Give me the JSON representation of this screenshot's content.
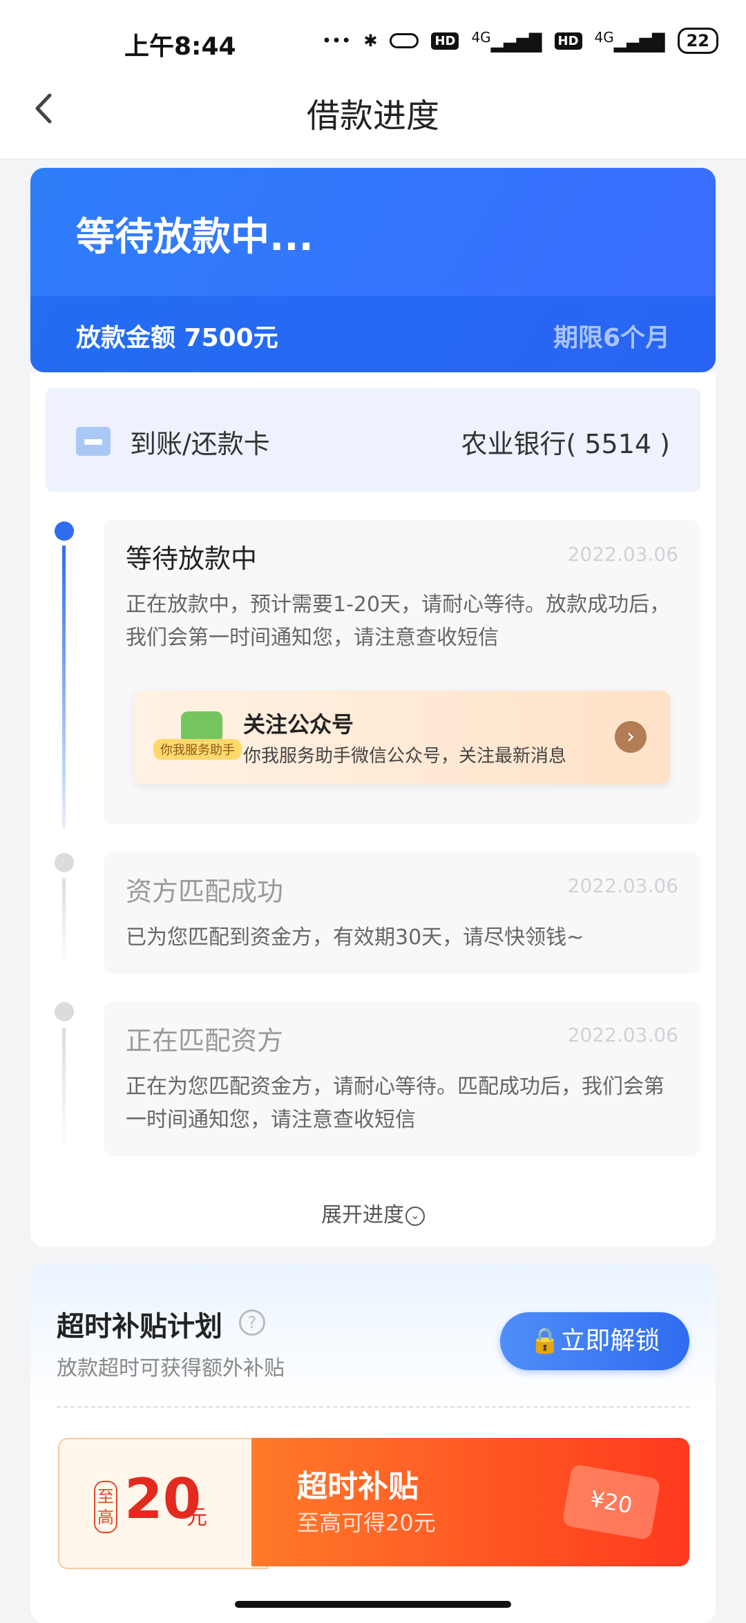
{
  "status_bar": {
    "time": "上午8:44",
    "hd1": "HD",
    "hd2": "HD",
    "net1": "4G",
    "net2": "4G",
    "battery": "22"
  },
  "nav": {
    "title": "借款进度"
  },
  "loan": {
    "status": "等待放款中...",
    "amount": "放款金额 7500元",
    "term": "期限6个月"
  },
  "card": {
    "label": "到账/还款卡",
    "bank": "农业银行( 5514 )"
  },
  "timeline": [
    {
      "title": "等待放款中",
      "date": "2022.03.06",
      "desc": [
        "正在放款中，预计需要1-20天，请耐心等待。放款成功后，",
        "我们会第一时间通知您，请注意查收短信"
      ]
    },
    {
      "title": "资方匹配成功",
      "date": "2022.03.06",
      "desc": [
        "已为您匹配到资金方，有效期30天，请尽快领钱~"
      ]
    },
    {
      "title": "正在匹配资方",
      "date": "2022.03.06",
      "desc": [
        "正在为您匹配资金方，请耐心等待。匹配成功后，我们会第",
        "一时间通知您，请注意查收短信"
      ]
    }
  ],
  "wechat": {
    "badge": "你我服务助手",
    "title": "关注公众号",
    "desc": "你我服务助手微信公众号，关注最新消息"
  },
  "expand": {
    "label": "展开进度"
  },
  "subsidy": {
    "title": "超时补贴计划",
    "desc": "放款超时可获得额外补贴",
    "unlock": "立即解锁",
    "coupon": {
      "prefix": "至高",
      "amount": "20",
      "unit": "元",
      "title": "超时补贴",
      "desc": "至高可得20元",
      "ticket": "¥20"
    }
  },
  "colors": {
    "primary": "#2f6cf0",
    "timeline_active": "#2f6cf0",
    "timeline_inactive": "#dcdcdc"
  }
}
